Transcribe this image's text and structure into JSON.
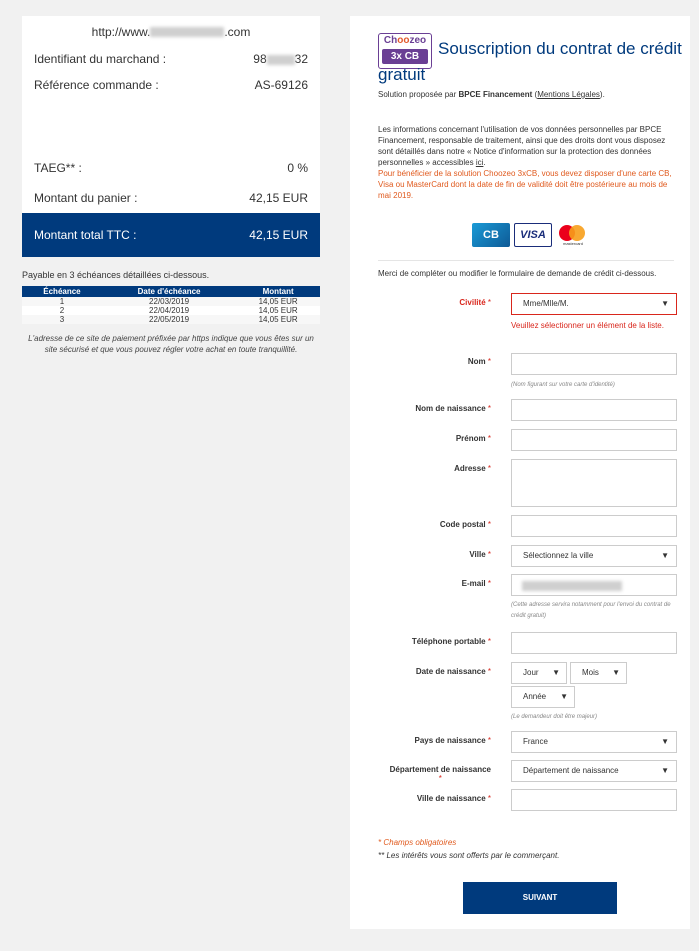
{
  "left": {
    "site_prefix": "http://www.",
    "site_suffix": ".com",
    "merchant_label": "Identifiant du marchand :",
    "merchant_prefix": "98",
    "merchant_suffix": "32",
    "order_label": "Référence commande :",
    "order_value": "AS-69126",
    "taeg_label": "TAEG** :",
    "taeg_value": "0 %",
    "cart_label": "Montant du panier :",
    "cart_value": "42,15 EUR",
    "total_label": "Montant total TTC :",
    "total_value": "42,15 EUR",
    "payable_text": "Payable en 3 échéances détaillées ci-dessous.",
    "schedule": {
      "headers": [
        "Échéance",
        "Date d'échéance",
        "Montant"
      ],
      "rows": [
        [
          "1",
          "22/03/2019",
          "14,05 EUR"
        ],
        [
          "2",
          "22/04/2019",
          "14,05 EUR"
        ],
        [
          "3",
          "22/05/2019",
          "14,05 EUR"
        ]
      ]
    },
    "secure_text": "L'adresse de ce site de paiement préfixée par https indique que vous êtes sur un site sécurisé et que vous pouvez régler votre achat en toute tranquillité."
  },
  "right": {
    "logo_top_a": "Ch",
    "logo_top_b": "oo",
    "logo_top_c": "zeo",
    "logo_bottom": "3x CB",
    "title": "Souscription du contrat de crédit gratuit",
    "subtitle_prefix": "Solution proposée par ",
    "subtitle_bold": "BPCE Financement",
    "subtitle_link": "Mentions Légales",
    "info_text": "Les informations concernant l'utilisation de vos données personnelles par BPCE Financement, responsable de traitement, ainsi que des droits dont vous disposez sont détaillés dans notre « Notice d'information sur la protection des données personnelles » accessibles ",
    "info_link": "ici",
    "warn_text": "Pour bénéficier de la solution Choozeo 3xCB, vous devez disposer d'une carte CB, Visa ou MasterCard dont la date de fin de validité doit être postérieure au mois de mai 2019.",
    "card_cb": "CB",
    "card_visa": "VISA",
    "card_mc": "mastercard",
    "intro": "Merci de compléter ou modifier le formulaire de demande de crédit ci-dessous.",
    "form": {
      "civility_label": "Civilité",
      "civility_value": "Mme/Mlle/M.",
      "civility_error": "Veuillez sélectionner un élément de la liste.",
      "name_label": "Nom",
      "name_hint": "(Nom figurant sur votre carte d'identité)",
      "birthname_label": "Nom de naissance",
      "firstname_label": "Prénom",
      "address_label": "Adresse",
      "postcode_label": "Code postal",
      "city_label": "Ville",
      "city_value": "Sélectionnez la ville",
      "email_label": "E-mail",
      "email_hint": "(Cette adresse servira notamment pour l'envoi du contrat de crédit gratuit)",
      "mobile_label": "Téléphone portable",
      "birthdate_label": "Date de naissance",
      "day_value": "Jour",
      "month_value": "Mois",
      "year_value": "Année",
      "birthdate_hint": "(Le demandeur doit être majeur)",
      "birth_country_label": "Pays de naissance",
      "birth_country_value": "France",
      "birth_dept_label": "Département de naissance",
      "birth_dept_value": "Département de naissance",
      "birth_city_label": "Ville de naissance",
      "star": "*"
    },
    "required_note": "* Champs obligatoires",
    "interest_note": "** Les intérêts vous sont offerts par le commerçant.",
    "submit_label": "SUIVANT"
  },
  "colors": {
    "brand": "#003a7d",
    "error": "#d9261c",
    "warning": "#e05a1e",
    "choozeo_purple": "#6a3f94"
  }
}
